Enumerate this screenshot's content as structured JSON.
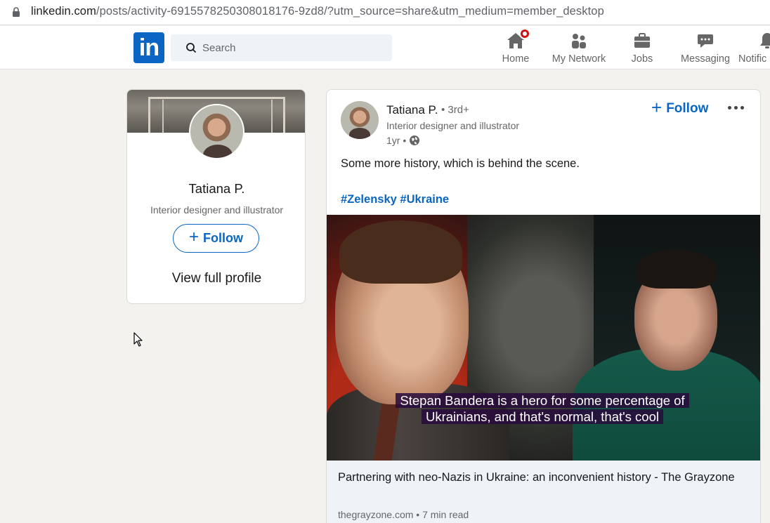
{
  "browser": {
    "url_host": "linkedin.com",
    "url_rest": "/posts/activity-6915578250308018176-9zd8/?utm_source=share&utm_medium=member_desktop"
  },
  "nav": {
    "logo_text": "in",
    "search_placeholder": "Search",
    "items": [
      {
        "label": "Home",
        "icon": "home-icon"
      },
      {
        "label": "My Network",
        "icon": "people-icon"
      },
      {
        "label": "Jobs",
        "icon": "briefcase-icon"
      },
      {
        "label": "Messaging",
        "icon": "chat-icon"
      },
      {
        "label": "Notific",
        "icon": "bell-icon"
      }
    ],
    "accent": "#0a66c2",
    "badge_color": "#cc1016"
  },
  "profile_card": {
    "name": "Tatiana P.",
    "headline": "Interior designer and illustrator",
    "follow_label": "Follow",
    "view_profile_label": "View full profile"
  },
  "post": {
    "author": "Tatiana P.",
    "degree": "• 3rd+",
    "headline": "Interior designer and illustrator",
    "time": "1yr •",
    "follow_label": "Follow",
    "text": "Some more history, which is behind the scene.",
    "hashtags": [
      "#Zelensky",
      "#Ukraine"
    ],
    "media_caption": "Stepan Bandera is a hero for some percentage of Ukrainians, and that's normal, that's cool",
    "link": {
      "title": "Partnering with neo-Nazis in Ukraine: an inconvenient history - The Grayzone",
      "meta": "thegrayzone.com • 7 min read"
    }
  }
}
